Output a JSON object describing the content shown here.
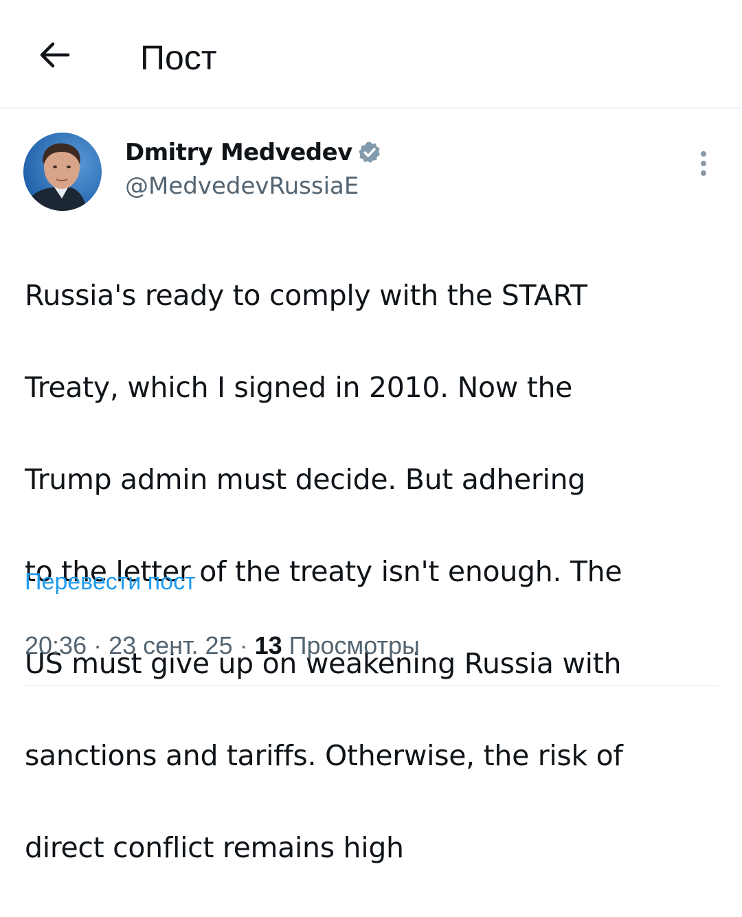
{
  "header": {
    "back_icon": "arrow-left-icon",
    "title": "Пост"
  },
  "author": {
    "display_name": "Dmitry Medvedev",
    "verified_icon": "verified-badge-icon",
    "verified_color": "#829aab",
    "handle": "@MedvedevRussiaE"
  },
  "post": {
    "lines": [
      "Russia's ready to comply with the START",
      "Treaty, which I signed in 2010. Now the",
      "Trump admin must decide. But adhering",
      "to the letter of the treaty isn't enough. The",
      "US must give up on weakening Russia with",
      "sanctions and tariffs. Otherwise, the risk of",
      "direct conflict remains high"
    ],
    "translate_label": "Перевести пост"
  },
  "meta": {
    "time": "20:36",
    "separator": " · ",
    "date": "23 сент. 25",
    "views_count": "13",
    "views_label": " Просмотры"
  },
  "colors": {
    "text": "#0f1419",
    "secondary": "#536471",
    "link": "#1d9bf0",
    "divider": "#eff3f4"
  }
}
